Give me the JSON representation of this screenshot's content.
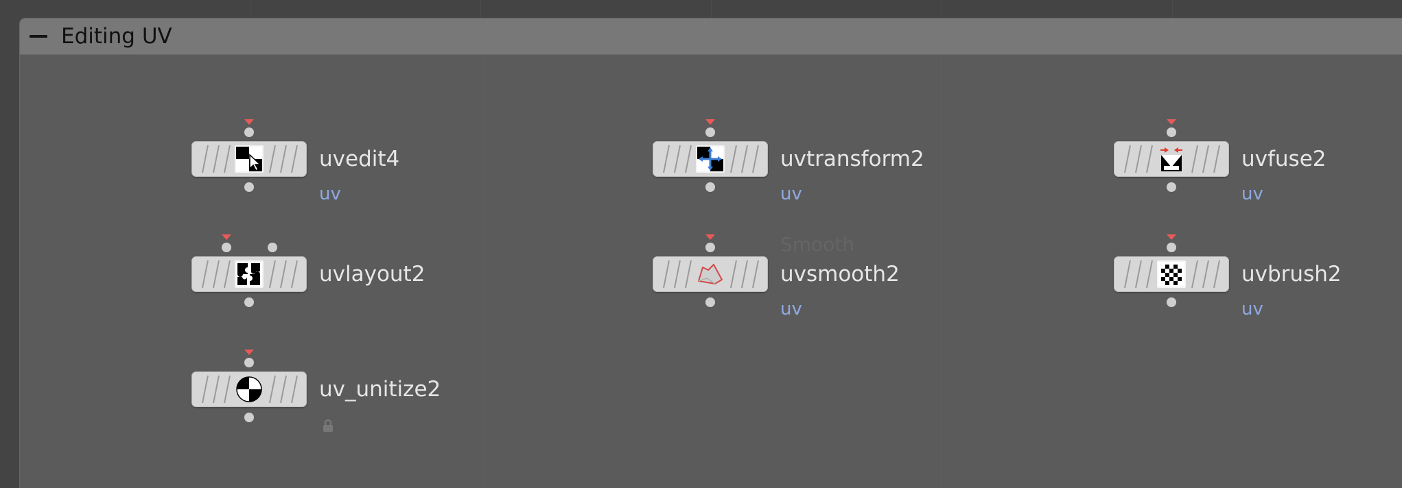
{
  "network_box": {
    "title": "Editing UV"
  },
  "nodes": [
    {
      "name": "uvedit4",
      "context": "uv",
      "icon": "uvedit-icon"
    },
    {
      "name": "uvtransform2",
      "context": "uv",
      "icon": "uvtransform-icon"
    },
    {
      "name": "uvfuse2",
      "context": "uv",
      "icon": "uvfuse-icon"
    },
    {
      "name": "uvlayout2",
      "context": "",
      "icon": "uvlayout-icon"
    },
    {
      "name": "uvsmooth2",
      "context": "uv",
      "icon": "uvsmooth-icon",
      "hover_label": "Smooth"
    },
    {
      "name": "uvbrush2",
      "context": "uv",
      "icon": "uvbrush-icon"
    },
    {
      "name": "uv_unitize2",
      "context": "",
      "icon": "uvunitize-icon"
    }
  ],
  "colors": {
    "canvas": "#444444",
    "network_box": "#5b5b5b",
    "network_box_header": "#787878",
    "node_body": "#d7d7d7",
    "node_name": "#e6e6e6",
    "context_label": "#8fa9e0",
    "input_flag": "#e85a5a"
  }
}
